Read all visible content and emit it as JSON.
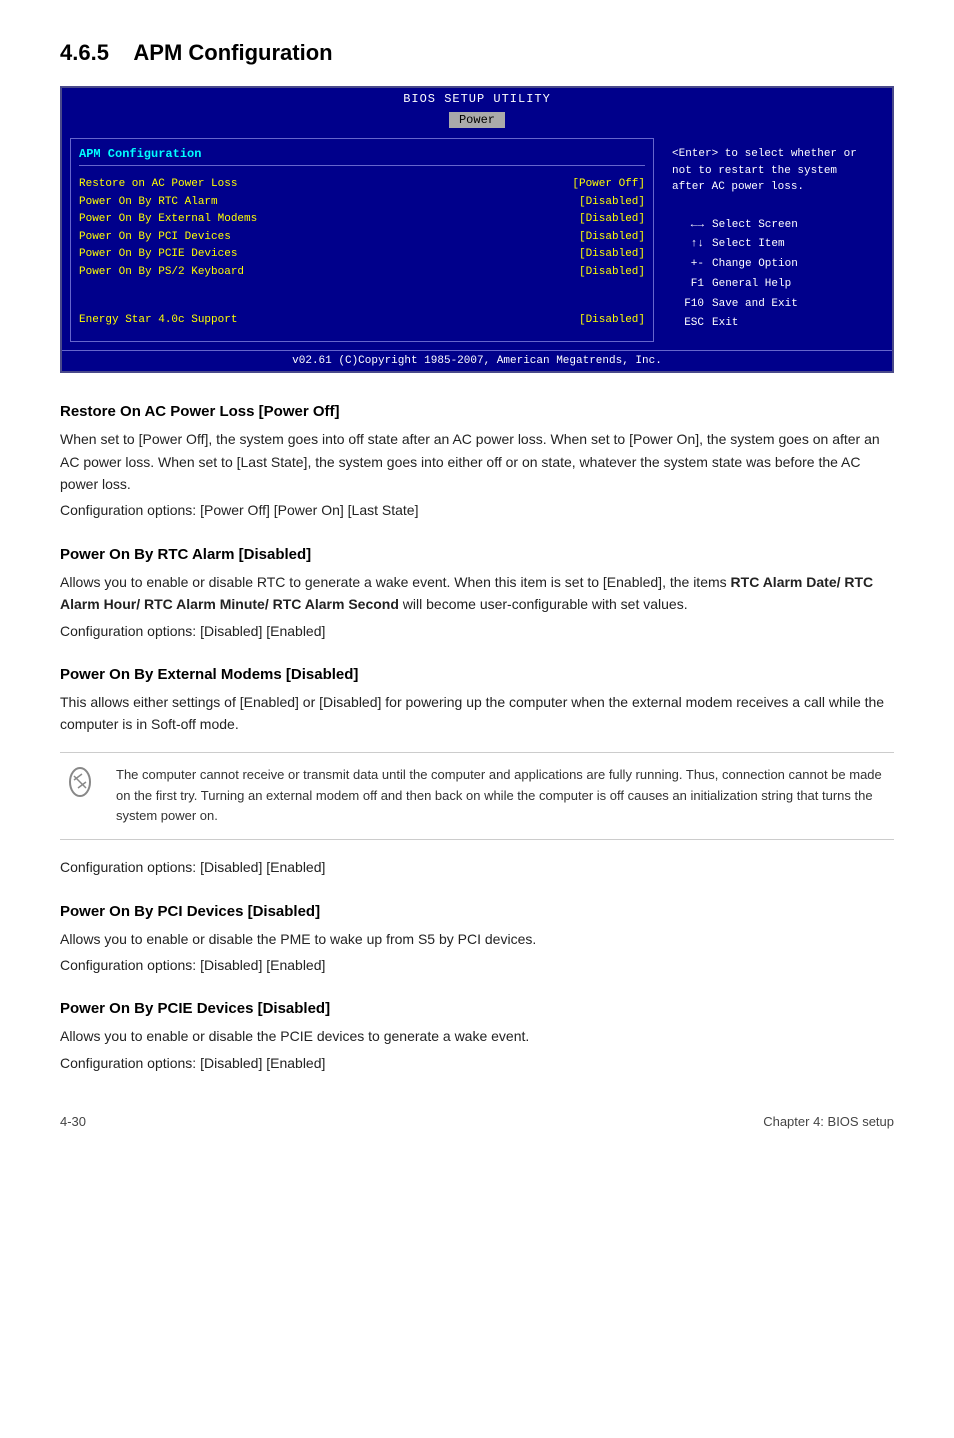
{
  "page": {
    "section_number": "4.6.5",
    "section_title": "APM Configuration",
    "footer_left": "4-30",
    "footer_right": "Chapter 4: BIOS setup"
  },
  "bios": {
    "title": "BIOS SETUP UTILITY",
    "tab": "Power",
    "section_label": "APM Configuration",
    "rows": [
      {
        "label": "Restore on AC Power Loss",
        "value": "[Power Off]"
      },
      {
        "label": "Power On By RTC Alarm",
        "value": "[Disabled]"
      },
      {
        "label": "Power On By External Modems",
        "value": "[Disabled]"
      },
      {
        "label": "Power On By PCI Devices",
        "value": "[Disabled]"
      },
      {
        "label": "Power On By PCIE Devices",
        "value": "[Disabled]"
      },
      {
        "label": "Power On By PS/2 Keyboard",
        "value": "[Disabled]"
      }
    ],
    "energy_label": "Energy Star 4.0c Support",
    "energy_value": "[Disabled]",
    "help_text": "<Enter> to select\nwhether or not to\nrestart the system\nafter AC power loss.",
    "keys": [
      {
        "key": "←→",
        "action": "Select Screen"
      },
      {
        "key": "↑↓",
        "action": "Select Item"
      },
      {
        "key": "+-",
        "action": "Change Option"
      },
      {
        "key": "F1",
        "action": "General Help"
      },
      {
        "key": "F10",
        "action": "Save and Exit"
      },
      {
        "key": "ESC",
        "action": "Exit"
      }
    ],
    "footer": "v02.61  (C)Copyright 1985-2007, American Megatrends, Inc."
  },
  "subsections": [
    {
      "id": "restore-ac",
      "title": "Restore On AC Power Loss [Power Off]",
      "body": "When set to [Power Off], the system goes into off state after an AC power loss. When set to [Power On], the system goes on after an AC power loss. When set to [Last State], the system goes into either off or on state, whatever the system state was before the AC power loss.",
      "config": "Configuration options: [Power Off] [Power On] [Last State]",
      "note": null
    },
    {
      "id": "rtc-alarm",
      "title": "Power On By RTC Alarm [Disabled]",
      "body": "Allows you to enable or disable RTC to generate a wake event. When this item is set to [Enabled], the items RTC Alarm Date/ RTC Alarm Hour/ RTC Alarm Minute/ RTC Alarm Second will become user-configurable with set values.",
      "config": "Configuration options: [Disabled] [Enabled]",
      "note": null
    },
    {
      "id": "ext-modems",
      "title": "Power On By External Modems [Disabled]",
      "body": "This allows either settings of [Enabled] or [Disabled] for powering up the computer when the external modem receives a call while the computer is in Soft-off mode.",
      "config": "Configuration options: [Disabled] [Enabled]",
      "note": "The computer cannot receive or transmit data until the computer and applications are fully running. Thus, connection cannot be made on the first try. Turning an external modem off and then back on while the computer is off causes an initialization string that turns the system power on."
    },
    {
      "id": "pci-devices",
      "title": "Power On By PCI Devices [Disabled]",
      "body": "Allows you to enable or disable the PME to wake up from S5 by PCI devices.",
      "config": "Configuration options: [Disabled] [Enabled]",
      "note": null
    },
    {
      "id": "pcie-devices",
      "title": "Power On By PCIE Devices [Disabled]",
      "body": "Allows you to enable or disable the PCIE devices to generate a wake event.",
      "config": "Configuration options: [Disabled] [Enabled]",
      "note": null
    }
  ]
}
